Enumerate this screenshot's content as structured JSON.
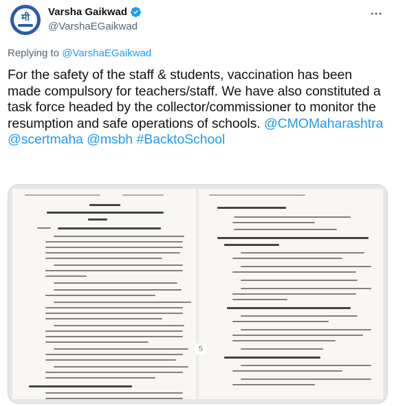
{
  "author": {
    "name": "Varsha Gaikwad",
    "handle": "@VarshaEGaikwad",
    "avatar_text": "मी",
    "verified_icon": "verified-badge-icon"
  },
  "reply": {
    "prefix": "Replying to ",
    "to": "@VarshaEGaikwad"
  },
  "tweet": {
    "text_1": "For the safety of the staff & students, vaccination has been made compulsory for teachers/staff. We have also constituted a task force headed by the collector/commissioner to monitor the resumption and safe operations of schools. ",
    "mention_1": "@CMOMaharashtra",
    "mention_2": "@scertmaha",
    "mention_3": "@msbh",
    "hashtag": "#BacktoSchool"
  },
  "media": {
    "page_number": "5"
  },
  "colors": {
    "link": "#1d9bf0",
    "verified": "#1d9bf0",
    "avatar": "#2a5caa"
  }
}
